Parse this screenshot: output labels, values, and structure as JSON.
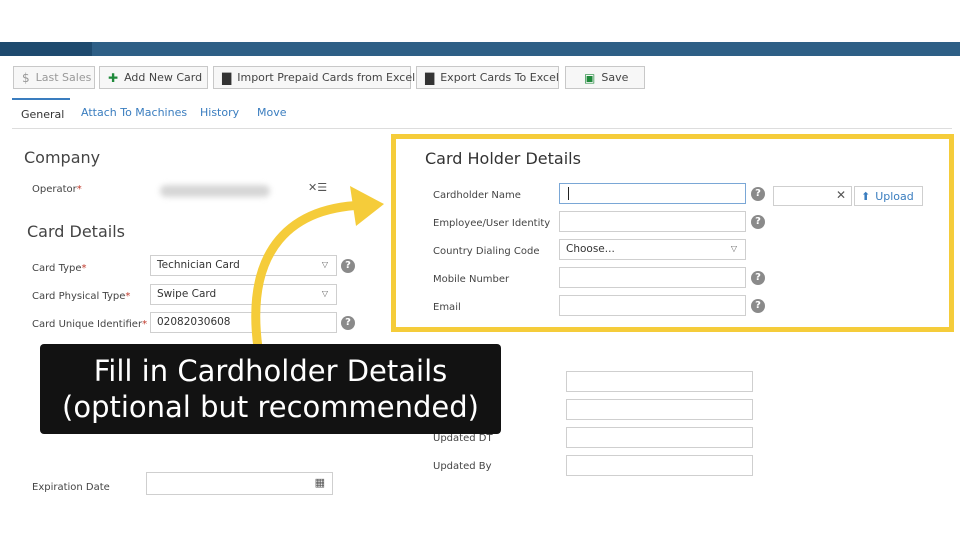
{
  "toolbar": {
    "last_sales": "Last Sales",
    "add_new_card": "Add New Card",
    "import_prepaid": "Import Prepaid Cards from Excel",
    "export_cards": "Export Cards To Excel",
    "save": "Save"
  },
  "tabs": [
    {
      "label": "General",
      "active": true
    },
    {
      "label": "Attach To Machines"
    },
    {
      "label": "History"
    },
    {
      "label": "Move"
    }
  ],
  "company": {
    "title": "Company",
    "operator_label": "Operator"
  },
  "card_details": {
    "title": "Card Details",
    "card_type_label": "Card Type",
    "card_type_value": "Technician Card",
    "physical_type_label": "Card Physical Type",
    "physical_type_value": "Swipe Card",
    "unique_id_label": "Card Unique Identifier",
    "unique_id_value": "02082030608",
    "expiration_label": "Expiration Date"
  },
  "cardholder": {
    "title": "Card Holder Details",
    "name_label": "Cardholder Name",
    "employee_label": "Employee/User Identity",
    "country_label": "Country Dialing Code",
    "country_value": "Choose...",
    "mobile_label": "Mobile Number",
    "email_label": "Email",
    "upload_label": "Upload"
  },
  "misc": {
    "updated_dt_label": "Updated DT",
    "updated_by_label": "Updated By"
  },
  "overlay": {
    "line1": "Fill in Cardholder Details",
    "line2": "(optional but recommended)"
  },
  "colors": {
    "highlight": "#f5cc3a",
    "topbar": "#2e5f86",
    "link": "#3a7dbf"
  }
}
